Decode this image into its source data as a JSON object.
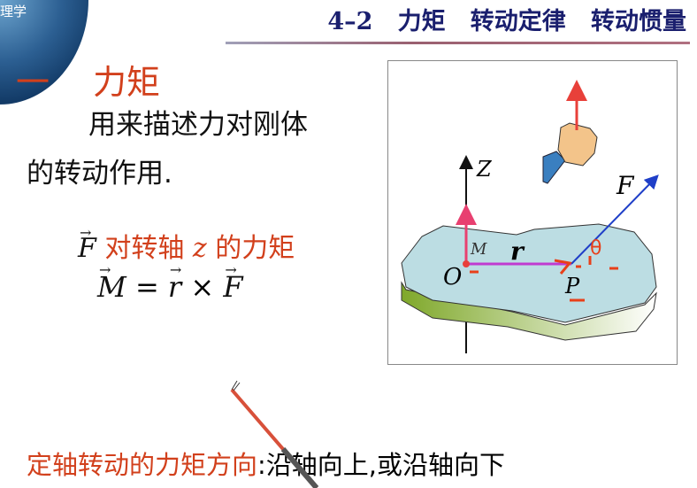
{
  "logo": {
    "text": "理学"
  },
  "header": {
    "title": "4–2   力矩   转动定律   转动惯量"
  },
  "section": {
    "number": "一",
    "title": "力矩"
  },
  "body": {
    "line1": "用来描述力对刚体",
    "line2": "的转动作用.",
    "torque_label_F": "F",
    "torque_label_rest": " 对转轴 ",
    "torque_label_z": "z",
    "torque_label_end": " 的力矩",
    "formula_M": "M",
    "formula_eq": " = ",
    "formula_r": "r",
    "formula_times": " × ",
    "formula_F": "F"
  },
  "figure": {
    "axis_label": "Z",
    "origin_label": "O",
    "point_label": "P",
    "torque_label": "M",
    "radius_label": "r",
    "force_label": "F",
    "annotation": "θ"
  },
  "footer": {
    "red_text": "定轴转动的力矩方向",
    "black_text": ":沿轴向上,或沿轴向下"
  },
  "colors": {
    "title": "#1a1f6e",
    "accent_red": "#d2401c",
    "disk": "#bcdde3",
    "force": "#1f3fc8",
    "radius": "#c03ad0"
  }
}
